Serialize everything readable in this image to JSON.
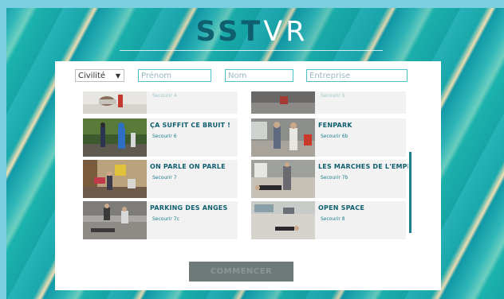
{
  "logo": {
    "part1": "SST",
    "part2": "VR"
  },
  "filters": {
    "civilite": "Civilité",
    "prenom_placeholder": "Prénom",
    "nom_placeholder": "Nom",
    "entreprise_placeholder": "Entreprise"
  },
  "cards": [
    {
      "title": "",
      "sub": "Secourir 4"
    },
    {
      "title": "",
      "sub": "Secourir 5"
    },
    {
      "title": "ÇA SUFFIT CE BRUIT !",
      "sub": "Secourir 6"
    },
    {
      "title": "FENPARK",
      "sub": "Secourir 6b"
    },
    {
      "title": "ON PARLE ON PARLE",
      "sub": "Secourir 7"
    },
    {
      "title": "LES MARCHES DE L'EMPEREUR",
      "sub": "Secourir 7b"
    },
    {
      "title": "PARKING DES ANGES",
      "sub": "Secourir 7c"
    },
    {
      "title": "OPEN SPACE",
      "sub": "Secourir 8"
    }
  ],
  "start_button": "COMMENCER",
  "colors": {
    "accent": "#0f5f6e",
    "teal": "#1cb3ad",
    "button": "#6e7a79"
  }
}
